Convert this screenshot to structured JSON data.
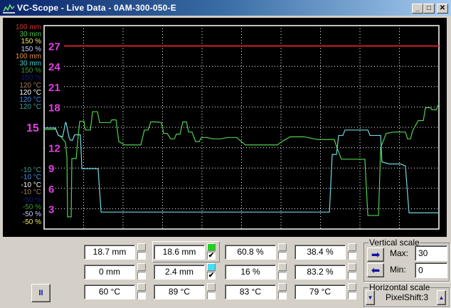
{
  "window": {
    "title": "VC-Scope  -  Live Data  -  0AM-300-050-E",
    "minimize": "_",
    "maximize": "□",
    "close": "✕"
  },
  "colors": {
    "grid": "#ffffff",
    "ticks": "#e040e0",
    "reference": "#d02020",
    "green": "#50d050",
    "cyan": "#70d8e0"
  },
  "legend_top": [
    {
      "text": "100 mm",
      "color": "#d03030"
    },
    {
      "text": "30 mm",
      "color": "#40c040"
    },
    {
      "text": "150 %",
      "color": "#e8e860"
    },
    {
      "text": "150 %",
      "color": "#c8c8ff"
    },
    {
      "text": "100 mm",
      "color": "#e09040"
    },
    {
      "text": "30 mm",
      "color": "#40d0d0"
    },
    {
      "text": "150 %",
      "color": "#30a030"
    },
    {
      "text": "150 %",
      "color": "#101880"
    },
    {
      "text": "120 °C",
      "color": "#a08060"
    },
    {
      "text": "120 °C",
      "color": "#ffffff"
    },
    {
      "text": "120 °C",
      "color": "#4090e0"
    },
    {
      "text": "120 °C",
      "color": "#40a0a0"
    }
  ],
  "legend_bottom": [
    {
      "text": "-10 °C",
      "color": "#40a0a0"
    },
    {
      "text": "-10 °C",
      "color": "#4090e0"
    },
    {
      "text": "-10 °C",
      "color": "#ffffff"
    },
    {
      "text": "-10 °C",
      "color": "#a08060"
    },
    {
      "text": "-50 %",
      "color": "#101880"
    },
    {
      "text": "-50 %",
      "color": "#30a030"
    },
    {
      "text": "-50 %",
      "color": "#c8c8ff"
    },
    {
      "text": "-50 %",
      "color": "#e8e860"
    }
  ],
  "chart_data": {
    "type": "line",
    "ylim": [
      0,
      30
    ],
    "xlim": [
      0,
      185
    ],
    "x_gridlines": 10,
    "yticks": [
      3,
      6,
      9,
      12,
      15,
      18,
      21,
      24,
      27
    ],
    "grid": true,
    "series": [
      {
        "name": "reference",
        "color": "#d02020",
        "points": [
          [
            0,
            27
          ],
          [
            185,
            27
          ]
        ]
      },
      {
        "name": "18.6 mm",
        "color": "#50d050",
        "points": [
          [
            0,
            14.7
          ],
          [
            4.3,
            14.7
          ],
          [
            5.3,
            14.8
          ],
          [
            6.7,
            13.8
          ],
          [
            8,
            13.6
          ],
          [
            8.7,
            13.3
          ],
          [
            10,
            12.8
          ],
          [
            10.7,
            10.6
          ],
          [
            11,
            1.8
          ],
          [
            12.7,
            1.8
          ],
          [
            13,
            10.4
          ],
          [
            15,
            10.4
          ],
          [
            16,
            13.8
          ],
          [
            16.7,
            15.9
          ],
          [
            18.7,
            15.9
          ],
          [
            19.3,
            14.6
          ],
          [
            21.7,
            14.6
          ],
          [
            22.7,
            17.3
          ],
          [
            25,
            17.3
          ],
          [
            26,
            15.7
          ],
          [
            31,
            15.7
          ],
          [
            31.7,
            16.1
          ],
          [
            33.7,
            16.1
          ],
          [
            35,
            12.9
          ],
          [
            37.7,
            12.4
          ],
          [
            45.3,
            12.4
          ],
          [
            47,
            14.6
          ],
          [
            48.7,
            14.6
          ],
          [
            50,
            15.8
          ],
          [
            52.7,
            15.8
          ],
          [
            55,
            15.7
          ],
          [
            56,
            14.1
          ],
          [
            57.7,
            14.1
          ],
          [
            59.3,
            13.3
          ],
          [
            61,
            13.3
          ],
          [
            62,
            14.0
          ],
          [
            63.7,
            14.0
          ],
          [
            65,
            15.8
          ],
          [
            66.7,
            15.8
          ],
          [
            67.7,
            14.3
          ],
          [
            69.3,
            14.3
          ],
          [
            71,
            12.9
          ],
          [
            72.7,
            12.9
          ],
          [
            73.7,
            13.5
          ],
          [
            76,
            13.5
          ],
          [
            79.3,
            13.3
          ],
          [
            82.7,
            13.3
          ],
          [
            86,
            13.5
          ],
          [
            90.3,
            13.5
          ],
          [
            94.3,
            12.4
          ],
          [
            109.3,
            12.4
          ],
          [
            112,
            13.0
          ],
          [
            115.3,
            13.6
          ],
          [
            121.7,
            13.6
          ],
          [
            128.3,
            13.2
          ],
          [
            136,
            13.2
          ],
          [
            137,
            12.2
          ],
          [
            139.3,
            10.3
          ],
          [
            150.3,
            10.3
          ],
          [
            151.7,
            2.0
          ],
          [
            156.7,
            2.0
          ],
          [
            157.7,
            12.0
          ],
          [
            160.3,
            14.1
          ],
          [
            163.7,
            14.3
          ],
          [
            169.3,
            14.3
          ],
          [
            170.3,
            13.3
          ],
          [
            171.7,
            13.3
          ],
          [
            172.7,
            14.5
          ],
          [
            175.3,
            16.0
          ],
          [
            177.7,
            16.0
          ],
          [
            178.7,
            17.9
          ],
          [
            181,
            17.9
          ],
          [
            181.7,
            17.6
          ],
          [
            183.7,
            17.6
          ],
          [
            185,
            18.5
          ]
        ]
      },
      {
        "name": "2.4 mm",
        "color": "#70d8e0",
        "points": [
          [
            0,
            14.9
          ],
          [
            3.7,
            14.9
          ],
          [
            5.3,
            14.9
          ],
          [
            6.7,
            13.8
          ],
          [
            8.7,
            13.6
          ],
          [
            10,
            15.7
          ],
          [
            10.3,
            15.7
          ],
          [
            11.7,
            13.5
          ],
          [
            12.3,
            13.1
          ],
          [
            13.3,
            13.1
          ],
          [
            14.3,
            13.9
          ],
          [
            17,
            13.9
          ],
          [
            17.7,
            8.9
          ],
          [
            25.3,
            8.9
          ],
          [
            26.7,
            2.5
          ],
          [
            133.7,
            2.5
          ],
          [
            135,
            11.0
          ],
          [
            137,
            11.0
          ],
          [
            138,
            13.8
          ],
          [
            140,
            13.8
          ],
          [
            141,
            14.6
          ],
          [
            151.7,
            14.6
          ],
          [
            152.7,
            13.8
          ],
          [
            157.7,
            13.8
          ],
          [
            158.3,
            9.9
          ],
          [
            161.7,
            9.6
          ],
          [
            167,
            9.6
          ],
          [
            169.3,
            9.3
          ],
          [
            171,
            2.4
          ],
          [
            185,
            2.4
          ]
        ]
      }
    ]
  },
  "readouts": [
    [
      "18.7 mm",
      "18.6 mm",
      "60.8 %",
      "38.4 %"
    ],
    [
      "0 mm",
      "2.4 mm",
      "16 %",
      "83.2 %"
    ],
    [
      "60 °C",
      "89 °C",
      "83 °C",
      "79 °C"
    ]
  ],
  "checks": {
    "row0_col1": "✔",
    "row1_col1": "✔"
  },
  "pause_label": "II",
  "vertical_scale": {
    "title": "Vertical scale",
    "max_label": "Max:",
    "max_value": "30",
    "min_label": "Min:",
    "min_value": "0",
    "up_arrow": "➡",
    "down_arrow": "⬅"
  },
  "horizontal_scale": {
    "title": "Horizontal scale",
    "value": "PixelShift:3",
    "down": "▼",
    "up": "▲"
  }
}
